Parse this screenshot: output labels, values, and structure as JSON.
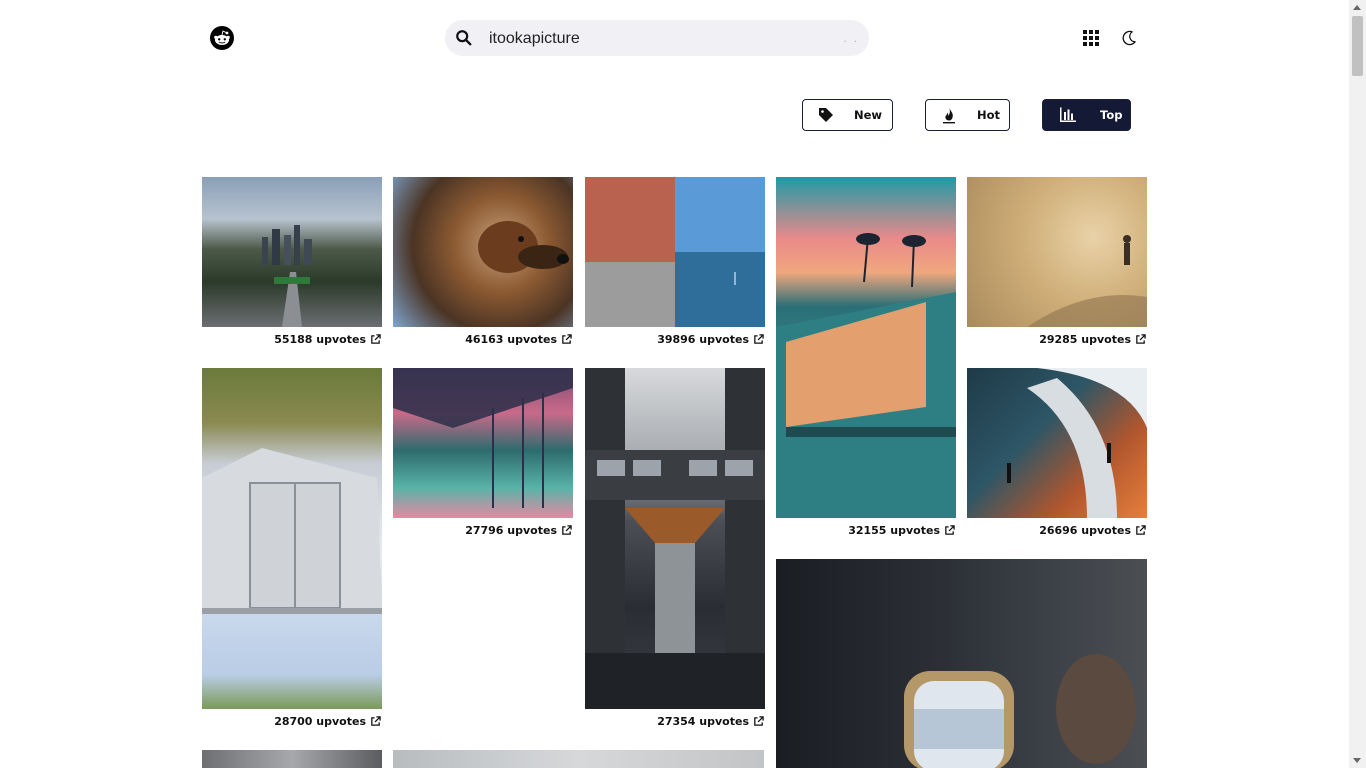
{
  "search": {
    "value": "itookapicture",
    "hint": ". ."
  },
  "sort": {
    "new_label": "New",
    "hot_label": "Hot",
    "top_label": "Top",
    "active": "top"
  },
  "posts": [
    {
      "upvotes": "55188 upvotes"
    },
    {
      "upvotes": "46163 upvotes"
    },
    {
      "upvotes": "39896 upvotes"
    },
    {
      "upvotes": "32155 upvotes"
    },
    {
      "upvotes": "29285 upvotes"
    },
    {
      "upvotes": "28700 upvotes"
    },
    {
      "upvotes": "27796 upvotes"
    },
    {
      "upvotes": "27354 upvotes"
    },
    {
      "upvotes": "26696 upvotes"
    }
  ],
  "icons": {
    "logo": "reddit-logo-icon",
    "search": "search-icon",
    "apps": "grid-icon",
    "theme": "moon-icon",
    "external": "external-link-icon"
  },
  "colors": {
    "accent": "#141a35",
    "search_bg": "#f0f0f5"
  }
}
